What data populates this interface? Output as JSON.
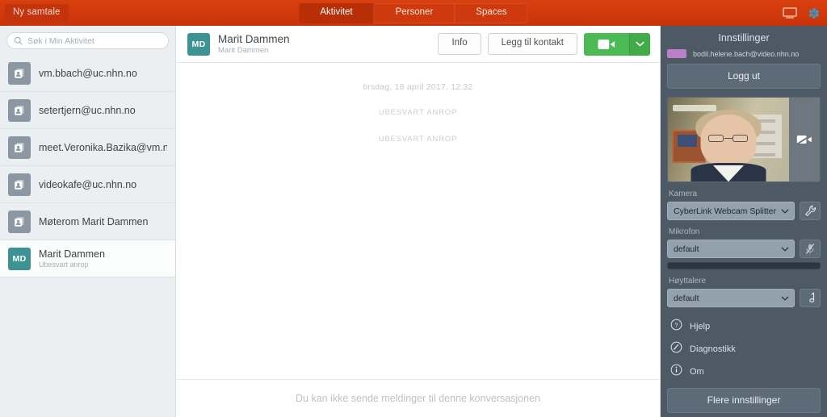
{
  "topbar": {
    "new_conversation_label": "Ny samtale",
    "tabs": [
      {
        "label": "Aktivitet",
        "active": true
      },
      {
        "label": "Personer",
        "active": false
      },
      {
        "label": "Spaces",
        "active": false
      }
    ],
    "icons": {
      "screen": "monitor-icon",
      "settings": "gear-icon"
    },
    "colors": {
      "bar": "#cc3507",
      "tab_active": "#b82e06",
      "gear": "#2aa5dd"
    }
  },
  "sidebar": {
    "search": {
      "placeholder": "Søk i Min Aktivitet",
      "value": ""
    },
    "items": [
      {
        "title": "vm.bbach@uc.nhn.no",
        "subtitle": "",
        "avatar_type": "group",
        "selected": false
      },
      {
        "title": "setertjern@uc.nhn.no",
        "subtitle": "",
        "avatar_type": "group",
        "selected": false
      },
      {
        "title": "meet.Veronika.Bazika@vm.n",
        "subtitle": "",
        "avatar_type": "group",
        "selected": false
      },
      {
        "title": "videokafe@uc.nhn.no",
        "subtitle": "",
        "avatar_type": "group",
        "selected": false
      },
      {
        "title": "Møterom Marit Dammen",
        "subtitle": "",
        "avatar_type": "group",
        "selected": false
      },
      {
        "title": "Marit Dammen",
        "subtitle": "Ubesvart anrop",
        "avatar_type": "initials",
        "initials": "MD",
        "selected": true
      }
    ]
  },
  "conversation": {
    "header": {
      "initials": "MD",
      "title": "Marit Dammen",
      "subtitle": "Marit Dammen",
      "info_label": "Info",
      "add_contact_label": "Legg til kontakt",
      "call_color": "#4cba54"
    },
    "body": {
      "date_separator": "tirsdag, 18 april 2017, 12:32",
      "events": [
        "UBESVART ANROP",
        "UBESVART ANROP"
      ]
    },
    "footer": {
      "message": "Du kan ikke sende meldinger til denne konversasjonen"
    }
  },
  "settings": {
    "title": "Innstillinger",
    "user_email": "bodil.helene.bach@video.nhn.no",
    "logout_label": "Logg ut",
    "camera": {
      "label": "Kamera",
      "selected": "CyberLink Webcam Splitter",
      "action_icon": "wrench-icon"
    },
    "microphone": {
      "label": "Mikrofon",
      "selected": "default",
      "action_icon": "mic-muted-icon"
    },
    "speakers": {
      "label": "Høyttalere",
      "selected": "default",
      "action_icon": "music-note-icon"
    },
    "menu": [
      {
        "label": "Hjelp",
        "icon": "question-circle-icon"
      },
      {
        "label": "Diagnostikk",
        "icon": "wrench-circle-icon"
      },
      {
        "label": "Om",
        "icon": "info-circle-icon"
      }
    ],
    "more_settings_label": "Flere innstillinger",
    "video_preview": {
      "overlay_icon": "camera-off-icon"
    },
    "colors": {
      "panel": "#4e5966",
      "avatar": "#b97fc7"
    }
  }
}
